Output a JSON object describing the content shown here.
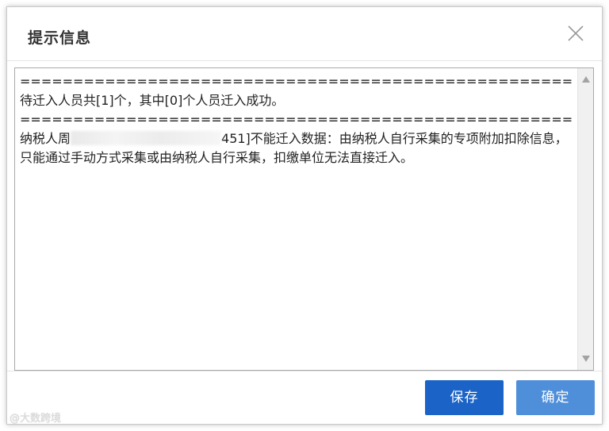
{
  "dialog": {
    "title": "提示信息"
  },
  "message": {
    "separator": "========================================================================================",
    "summary": "待迁入人员共[1]个，其中[0]个人员迁入成功。",
    "detail_prefix": "纳税人周",
    "detail_suffix": "451]不能迁入数据：由纳税人自行采集的专项附加扣除信息，只能通过手动方式采集或由纳税人自行采集，扣缴单位无法直接迁入。"
  },
  "buttons": {
    "save_label": "保存",
    "ok_label": "确定"
  },
  "watermark": {
    "text": "@大数跨境"
  },
  "colors": {
    "save_button": "#1b63c6",
    "ok_button": "#4f8fd9",
    "title_text": "#333333"
  },
  "icons": {
    "close": "close-icon",
    "scroll_up": "scroll-up-arrow-icon",
    "scroll_down": "scroll-down-arrow-icon"
  }
}
